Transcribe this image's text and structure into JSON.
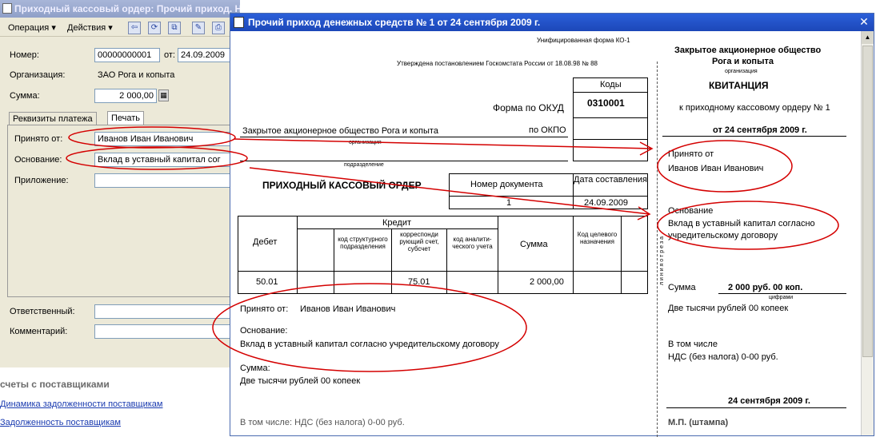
{
  "back_window": {
    "title": "Приходный кассовый ордер: Прочий приход. Не проведен",
    "toolbar": {
      "operation": "Операция ▾",
      "actions": "Действия ▾"
    },
    "fields": {
      "number_label": "Номер:",
      "number_value": "00000000001",
      "date_label": "от:",
      "date_value": "24.09.2009",
      "org_label": "Организация:",
      "org_value": "ЗАО Рога и копыта",
      "sum_label": "Сумма:",
      "sum_value": "2 000,00"
    },
    "tabs": [
      "Реквизиты платежа",
      "Печать"
    ],
    "panel": {
      "accepted_label": "Принято от:",
      "accepted_value": "Иванов Иван Иванович",
      "basis_label": "Основание:",
      "basis_value": "Вклад в уставный капитал сог",
      "attachment_label": "Приложение:"
    },
    "bottom": {
      "responsible_label": "Ответственный:",
      "comment_label": "Комментарий:"
    }
  },
  "links": {
    "header": "счеты с поставщиками",
    "items": [
      "Динамика задолженности поставщикам",
      "Задолженность поставщикам"
    ]
  },
  "front_window": {
    "title": "Прочий приход денежных средств № 1 от 24 сентября 2009 г.",
    "close": "✕"
  },
  "doc": {
    "form_name": "Унифицированная форма КО-1",
    "approved": "Утверждена постановлением Госкомстата России от 18.08.98 № 88",
    "codes_header": "Коды",
    "okud_label": "Форма по ОКУД",
    "okud_value": "0310001",
    "okpo_label": "по ОКПО",
    "org_name": "Закрытое акционерное общество Рога и копыта",
    "org_caption": "организация",
    "dept_caption": "подразделение",
    "title": "ПРИХОДНЫЙ КАССОВЫЙ ОРДЕР",
    "docnum_header": "Номер документа",
    "date_header": "Дата составления",
    "docnum_value": "1",
    "date_value": "24.09.2009",
    "table": {
      "debit": "Дебет",
      "credit": "Кредит",
      "col_struct": "код структурного подразделения",
      "col_corr": "корреспонди рующий счет, субсчет",
      "col_analytic": "код аналити- ческого учета",
      "col_sum": "Сумма",
      "col_purpose": "Код целевого назначения",
      "row_debit": "50.01",
      "row_corr": "75.01",
      "row_sum": "2 000,00"
    },
    "accepted": "Принято от:",
    "accepted_name": "Иванов Иван Иванович",
    "basis": "Основание:",
    "basis_text": "Вклад в уставный капитал согласно учредительскому договору",
    "sum": "Сумма:",
    "sum_words": "Две тысячи рублей 00 копеек",
    "including": "В том числе: НДС (без налога) 0-00 руб."
  },
  "receipt": {
    "org_line1": "Закрытое акционерное общество",
    "org_line2": "Рога и копыта",
    "org_caption": "организация",
    "title": "КВИТАНЦИЯ",
    "to_order": "к приходному кассовому ордеру № 1",
    "date": "от  24 сентября 2009 г.",
    "accepted_label": "Принято от",
    "accepted_name": "Иванов Иван Иванович",
    "basis_label": "Основание",
    "basis_text1": "Вклад в уставный капитал согласно",
    "basis_text2": "учредительскому договору",
    "sum_label": "Сумма",
    "sum_value": "2 000 руб. 00 коп.",
    "sum_caption": "цифрами",
    "sum_words": "Две тысячи рублей 00 копеек",
    "incl_label": "В том числе",
    "vat": "НДС (без налога) 0-00 руб.",
    "date_bottom": "24 сентября 2009 г.",
    "mp": "М.П. (штампа)",
    "cut_line": "л и н и я   о т р е з а"
  },
  "colors": {
    "title_active": "#1c47b8",
    "annotation": "#d40000",
    "link": "#1a3bb0"
  }
}
